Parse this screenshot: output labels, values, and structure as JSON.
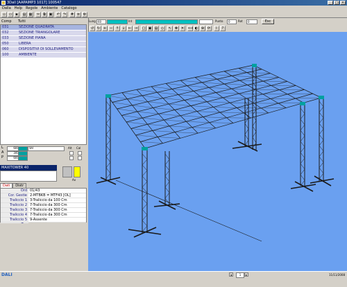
{
  "window": {
    "title": "3Dall [AAPAIMP3 1017] 100547"
  },
  "menu": [
    "Dalla",
    "Help",
    "Regole",
    "Ambiente",
    "Catalogo"
  ],
  "components": {
    "headers": [
      "Comp",
      "Tutti"
    ],
    "rows": [
      {
        "code": "031",
        "name": "SEZIONE QUADRATA"
      },
      {
        "code": "032",
        "name": "SEZIONE TRIANGOLARE"
      },
      {
        "code": "033",
        "name": "SEZIONE PIANA"
      },
      {
        "code": "050",
        "name": "LIBERA"
      },
      {
        "code": "060",
        "name": "DISPOSITIVI DI SOLLEVAMENTO"
      },
      {
        "code": "100",
        "name": "AMBIENTE"
      }
    ]
  },
  "props": {
    "rows": [
      {
        "label": "L",
        "value": "600"
      },
      {
        "label": "A",
        "value": "340"
      },
      {
        "label": "P",
        "value": "600"
      }
    ],
    "dropdown": "Vel",
    "check_labels": [
      "Alt",
      "Cal"
    ],
    "axis_label": "Ax"
  },
  "tower_name": "MAXITOWER 40",
  "tabs": [
    "Dati",
    "Distr"
  ],
  "detail": [
    {
      "key": "Ord",
      "value": "01/43"
    },
    {
      "key": "Cor. Gestie",
      "value": "2-MTBKB = MTF43 [OL]"
    },
    {
      "key": "Traliccio 1",
      "value": "3-Traliccio da 100 Cm"
    },
    {
      "key": "Traliccio 2",
      "value": "7-Traliccio da 300 Cm"
    },
    {
      "key": "Traliccio 3",
      "value": "7-Traliccio da 300 Cm"
    },
    {
      "key": "Traliccio 4",
      "value": "7-Traliccio da 300 Cm"
    },
    {
      "key": "Traliccio 5",
      "value": "9-Assente"
    },
    {
      "key": "Top",
      "value": "✓"
    }
  ],
  "viewbar": {
    "lung_label": "Lung",
    "lung_value": "60",
    "int_label": "Int",
    "punto_label": "Punto",
    "punto_value": "0",
    "r_label": "Rot",
    "r_value": "0",
    "exit_label": "Esc"
  },
  "status": {
    "logo": "DALI",
    "page": "1",
    "coords": "11/11/2008"
  },
  "colors": {
    "viewport_bg": "#6aa0f0",
    "truss": "#1a1a1a",
    "highlight": "#00a0a0"
  }
}
